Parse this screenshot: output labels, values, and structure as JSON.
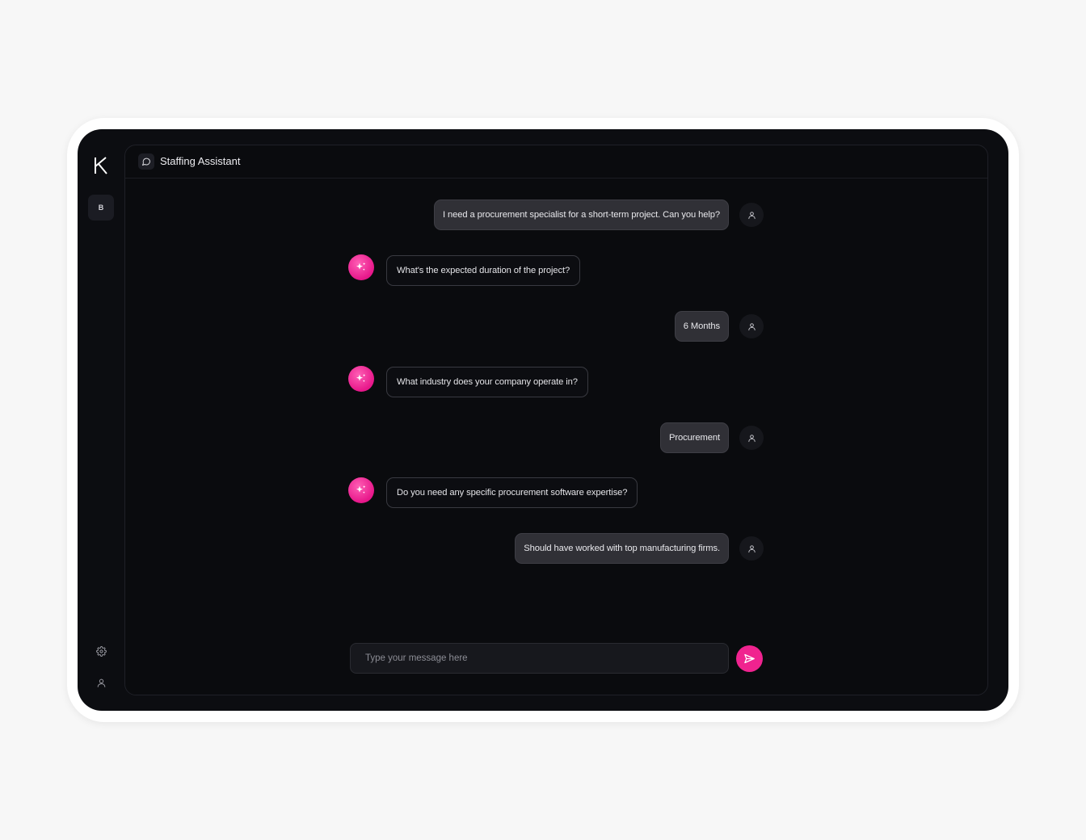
{
  "app": {
    "logo_letter": "K",
    "workspace_badge": "B",
    "title": "Staffing Assistant",
    "accent_color": "#f0238f"
  },
  "messages": [
    {
      "role": "user",
      "text": "I need a procurement specialist for a short-term project. Can you help?"
    },
    {
      "role": "bot",
      "text": "What's the expected duration of the project?"
    },
    {
      "role": "user",
      "text": "6 Months"
    },
    {
      "role": "bot",
      "text": "What industry does your company operate in?"
    },
    {
      "role": "user",
      "text": "Procurement"
    },
    {
      "role": "bot",
      "text": "Do you need any specific procurement software expertise?"
    },
    {
      "role": "user",
      "text": "Should have worked with top manufacturing firms."
    }
  ],
  "composer": {
    "placeholder": "Type your message here",
    "value": ""
  },
  "icons": {
    "header": "chat-bubble-icon",
    "bot_avatar": "sparkles-icon",
    "user_avatar": "user-icon",
    "settings": "gear-icon",
    "profile": "user-icon",
    "send": "send-icon"
  }
}
